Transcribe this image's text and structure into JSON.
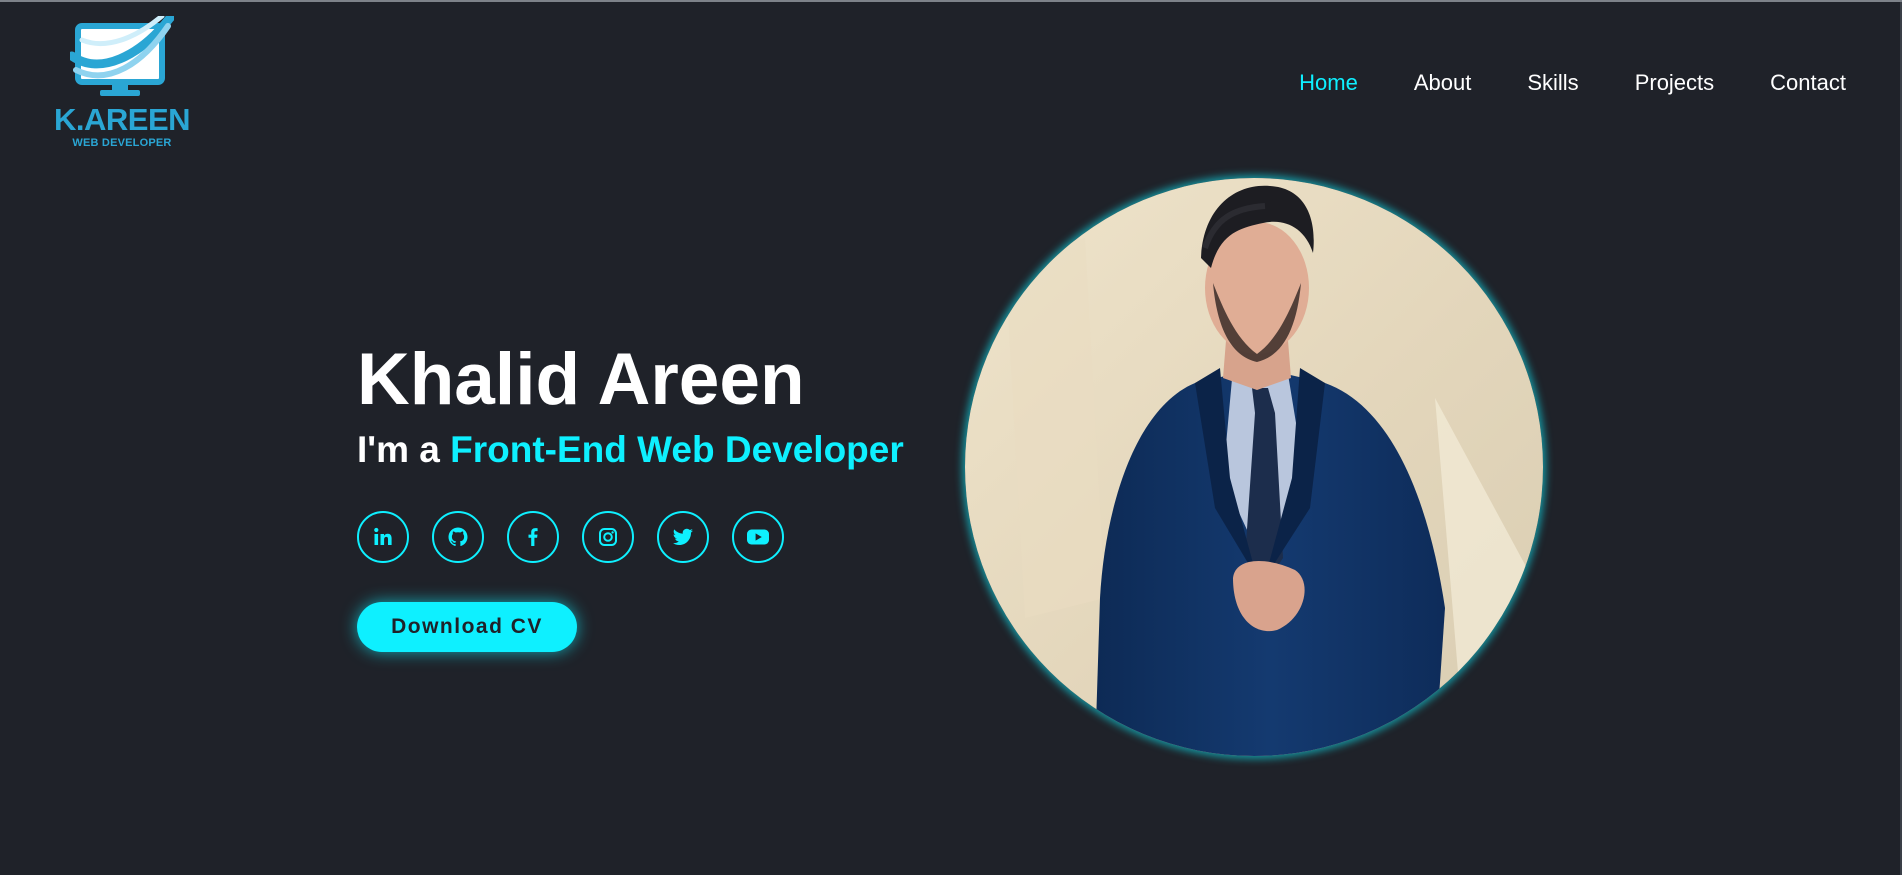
{
  "brand": {
    "name": "K.AREEN",
    "tagline": "WEB DEVELOPER",
    "mark_icon": "monitor-swoosh-icon",
    "color": "#2aa6d4"
  },
  "nav": {
    "items": [
      {
        "label": "Home",
        "active": true
      },
      {
        "label": "About",
        "active": false
      },
      {
        "label": "Skills",
        "active": false
      },
      {
        "label": "Projects",
        "active": false
      },
      {
        "label": "Contact",
        "active": false
      }
    ]
  },
  "hero": {
    "name": "Khalid Areen",
    "role_prefix": "I'm a ",
    "role_highlight": "Front-End Web Developer",
    "socials": [
      {
        "icon": "linkedin-icon"
      },
      {
        "icon": "github-icon"
      },
      {
        "icon": "facebook-icon"
      },
      {
        "icon": "instagram-icon"
      },
      {
        "icon": "twitter-icon"
      },
      {
        "icon": "youtube-icon"
      }
    ],
    "cv_button": "Download CV",
    "portrait_alt": "portrait-photo"
  },
  "colors": {
    "background": "#1f2229",
    "accent": "#0ef0ff",
    "text": "#ffffff"
  }
}
